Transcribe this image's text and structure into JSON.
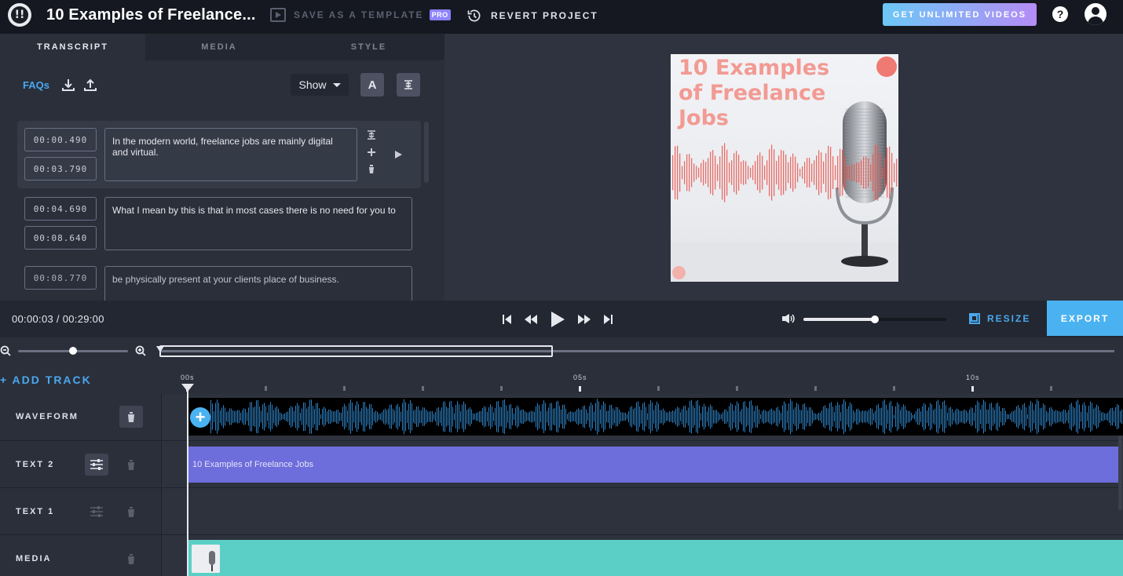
{
  "header": {
    "title": "10 Examples of Freelance...",
    "save_template_label": "SAVE AS A TEMPLATE",
    "pro_badge": "PRO",
    "revert_label": "REVERT PROJECT",
    "get_unlimited_label": "GET UNLIMITED VIDEOS",
    "help_glyph": "?"
  },
  "tabs": [
    {
      "label": "TRANSCRIPT",
      "active": true
    },
    {
      "label": "MEDIA",
      "active": false
    },
    {
      "label": "STYLE",
      "active": false
    }
  ],
  "transcript_toolbar": {
    "faqs_label": "FAQs",
    "show_select_value": "Show",
    "text_style_glyph": "A"
  },
  "segments": [
    {
      "start": "00:00.490",
      "end": "00:03.790",
      "text": "In the modern world, freelance jobs are mainly digital and virtual.",
      "active": true
    },
    {
      "start": "00:04.690",
      "end": "00:08.640",
      "text": "What I mean by this is that in most cases there is no need for you to",
      "active": false
    },
    {
      "start": "00:08.770",
      "end": "",
      "text": "be physically present at your clients place of business.",
      "active": false
    }
  ],
  "preview": {
    "title": "10 Examples of Freelance Jobs"
  },
  "playback": {
    "time_readout": "00:00:03 / 00:29:00",
    "volume_level": 0.5,
    "resize_label": "RESIZE",
    "export_label": "EXPORT"
  },
  "zoom": {
    "level": 0.5,
    "viewport_start": 0.0,
    "viewport_fraction": 0.41
  },
  "timeline": {
    "add_track_label": "+ ADD TRACK",
    "ruler_labels": [
      "00s",
      "05s",
      "10s"
    ],
    "tracks": [
      {
        "name": "WAVEFORM"
      },
      {
        "name": "TEXT 2",
        "clip_text": "10 Examples of Freelance Jobs"
      },
      {
        "name": "TEXT 1"
      },
      {
        "name": "MEDIA"
      }
    ]
  },
  "icons": {
    "logo": "logo-icon",
    "save_template": "template-icon",
    "revert": "history-icon",
    "help": "help-icon",
    "account": "account-icon",
    "download": "download-icon",
    "upload": "upload-icon",
    "split": "split-icon",
    "add": "plus-icon",
    "delete": "trash-icon",
    "play_segment": "play-icon",
    "skip_start": "skip-start-icon",
    "rewind": "rewind-icon",
    "play": "play-icon",
    "forward": "fast-forward-icon",
    "skip_end": "skip-end-icon",
    "volume": "volume-icon",
    "zoom_out": "zoom-out-icon",
    "zoom_in": "zoom-in-icon",
    "settings": "sliders-icon"
  },
  "colors": {
    "accent": "#4ab2f0",
    "text2_clip": "#6d6ddb",
    "media_clip": "#5bcfc6",
    "preview_title": "#f29a93",
    "waveform": "#2e7fc0"
  }
}
